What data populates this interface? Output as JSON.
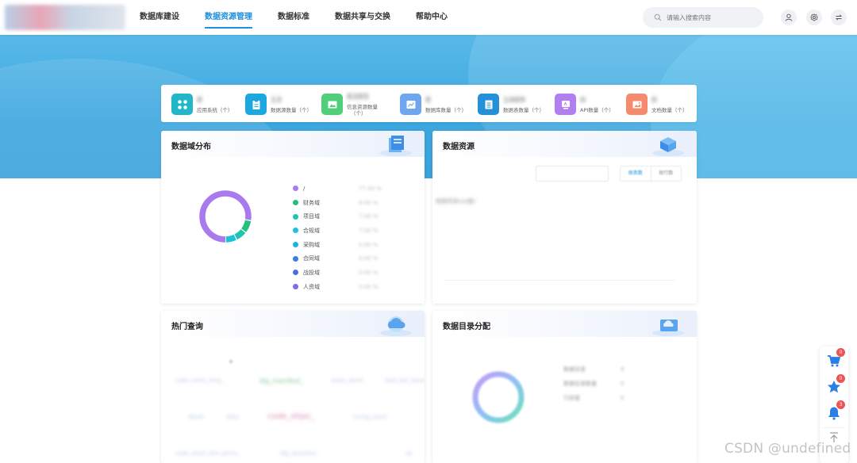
{
  "header": {
    "nav": [
      {
        "label": "数据库建设",
        "active": false
      },
      {
        "label": "数据资源管理",
        "active": true
      },
      {
        "label": "数据标准",
        "active": false
      },
      {
        "label": "数据共享与交换",
        "active": false
      },
      {
        "label": "帮助中心",
        "active": false
      }
    ],
    "search_placeholder": "请输入搜索内容",
    "icons": [
      "user-icon",
      "gear-icon",
      "swap-icon"
    ],
    "accent": "#1e8fdd"
  },
  "stats": [
    {
      "label": "应用系统（个）",
      "value": "8",
      "color": "#22b7c8",
      "icon": "apps-icon"
    },
    {
      "label": "数据源数量（个）",
      "value": "13",
      "color": "#1da7e0",
      "icon": "clipboard-icon"
    },
    {
      "label": "信息资源数量\n（个）",
      "value": "8385",
      "color": "#4fcf79",
      "icon": "image-icon"
    },
    {
      "label": "数据库数量（个）",
      "value": "8",
      "color": "#6ea7ef",
      "icon": "chart-icon"
    },
    {
      "label": "数据表数量（个）",
      "value": "1489",
      "color": "#2490d8",
      "icon": "table-icon"
    },
    {
      "label": "API数量（个）",
      "value": "0",
      "color": "#b17ff0",
      "icon": "api-icon"
    },
    {
      "label": "文档数量（个）",
      "value": "0",
      "color": "#f58a6e",
      "icon": "doc-icon"
    }
  ],
  "domain_panel": {
    "title": "数据域分布",
    "legend": [
      {
        "name": "/",
        "value": "77.00 %",
        "color": "#a979ee"
      },
      {
        "name": "财务域",
        "value": "8.00 %",
        "color": "#24c17e"
      },
      {
        "name": "项目域",
        "value": "7.00 %",
        "color": "#20c3b4"
      },
      {
        "name": "合规域",
        "value": "7.00 %",
        "color": "#1cc2d8"
      },
      {
        "name": "采购域",
        "value": "0.00 %",
        "color": "#1ab4dc"
      },
      {
        "name": "合同域",
        "value": "0.00 %",
        "color": "#3a7ee8"
      },
      {
        "name": "战投域",
        "value": "0.00 %",
        "color": "#4b6de0"
      },
      {
        "name": "人资域",
        "value": "0.00 %",
        "color": "#7c6ee6"
      }
    ]
  },
  "resource_panel": {
    "title": "数据资源",
    "filter_tab_1": "按表数",
    "filter_tab_2": "按行数",
    "note": "数据资源(sql量)"
  },
  "hot_panel": {
    "title": "热门查询",
    "terms": [
      "code_stock_emp_",
      "dlg_manifest_",
      "stock_stock",
      "dwd_bid_stock",
      "detail",
      "data",
      "code_ohjsc_",
      "lscmg_stock",
      "code_stock_dim_perm_",
      "dlg_stockfact",
      "ok"
    ]
  },
  "catalog_panel": {
    "title": "数据目录分配",
    "legend": [
      {
        "name": "数据目录",
        "value": "0"
      },
      {
        "name": "数据目录数量",
        "value": "0"
      },
      {
        "name": "已挂载",
        "value": "0"
      }
    ]
  },
  "side_tools": [
    {
      "icon": "cart-icon",
      "badge": "0"
    },
    {
      "icon": "star-icon",
      "badge": "0"
    },
    {
      "icon": "bell-icon",
      "badge": "3"
    },
    {
      "icon": "back-to-top-icon",
      "badge": ""
    }
  ],
  "watermark": "CSDN @undefined"
}
